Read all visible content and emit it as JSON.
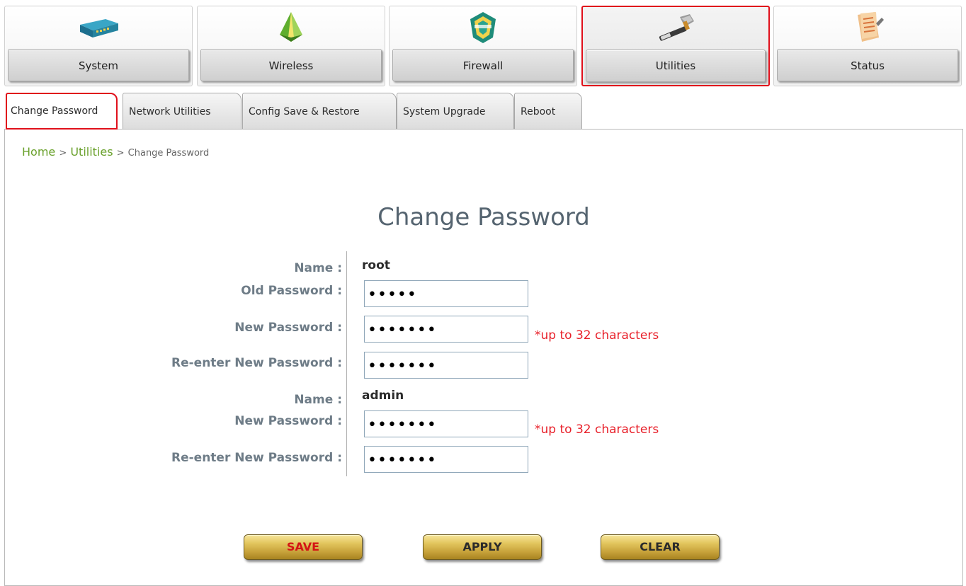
{
  "nav": {
    "items": [
      {
        "label": "System",
        "icon": "router-device-icon"
      },
      {
        "label": "Wireless",
        "icon": "wireless-pyramid-icon"
      },
      {
        "label": "Firewall",
        "icon": "firewall-shield-icon"
      },
      {
        "label": "Utilities",
        "icon": "hammer-icon",
        "selected": true
      },
      {
        "label": "Status",
        "icon": "status-document-icon"
      }
    ]
  },
  "tabs": [
    {
      "label": "Change Password",
      "active": true
    },
    {
      "label": "Network Utilities"
    },
    {
      "label": "Config Save & Restore"
    },
    {
      "label": "System Upgrade"
    },
    {
      "label": "Reboot"
    }
  ],
  "breadcrumb": {
    "home": "Home",
    "sep1": ">",
    "section": "Utilities",
    "sep2": ">",
    "current": "Change Password"
  },
  "form": {
    "title": "Change Password",
    "root": {
      "name_label": "Name :",
      "name_value": "root",
      "old_password_label": "Old Password :",
      "old_password_value": "•••••",
      "new_password_label": "New Password :",
      "new_password_value": "•••••••",
      "new_password_hint": "*up to 32 characters",
      "reenter_label": "Re-enter New Password :",
      "reenter_value": "•••••••"
    },
    "admin": {
      "name_label": "Name :",
      "name_value": "admin",
      "new_password_label": "New Password :",
      "new_password_value": "•••••••",
      "new_password_hint": "*up to 32 characters",
      "reenter_label": "Re-enter New Password :",
      "reenter_value": "•••••••"
    }
  },
  "buttons": {
    "save": "SAVE",
    "apply": "APPLY",
    "clear": "CLEAR"
  },
  "colors": {
    "selected_outline": "#e0101b",
    "breadcrumb_link": "#6aa12c",
    "hint": "#e8202a",
    "button_gold": "#d8b44a"
  }
}
